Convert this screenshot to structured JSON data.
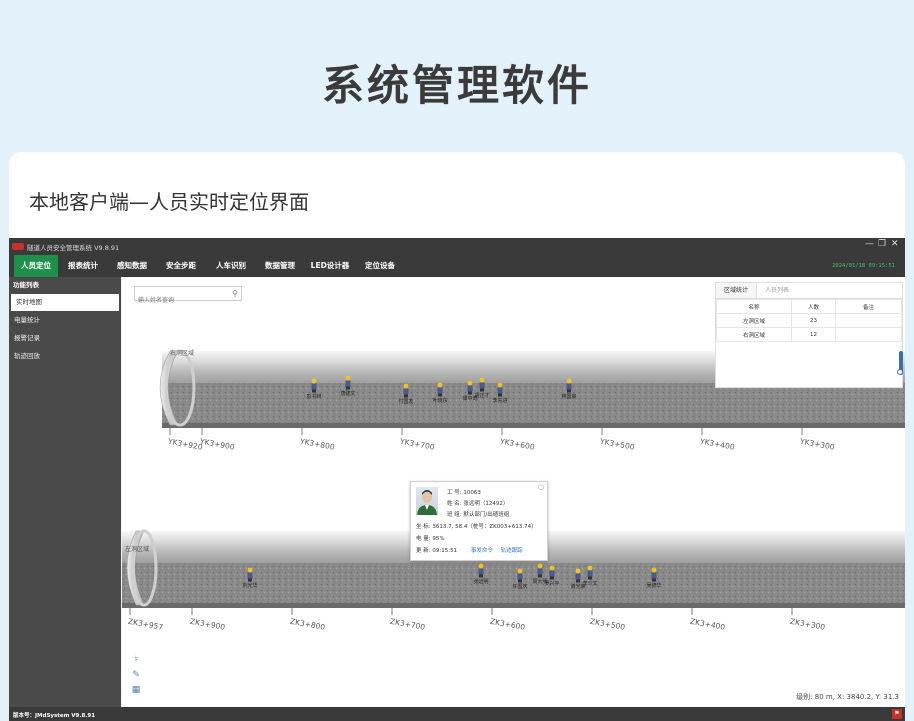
{
  "hero_title": "系统管理软件",
  "caption": "本地客户端—人员实时定位界面",
  "app": {
    "window_title": "隧道人员安全管理系统 V9.8.91",
    "logo_text": "JMD",
    "window_controls": [
      "—",
      "❐",
      "✕"
    ],
    "clock": "2024/01/18 09:15:51",
    "menu": [
      {
        "label": "人员定位",
        "active": true
      },
      {
        "label": "报表统计",
        "active": false
      },
      {
        "label": "感知数据",
        "active": false
      },
      {
        "label": "安全步距",
        "active": false
      },
      {
        "label": "人车识别",
        "active": false
      },
      {
        "label": "数据管理",
        "active": false
      },
      {
        "label": "LED设计器",
        "active": false
      },
      {
        "label": "定位设备",
        "active": false
      }
    ],
    "sidebar": {
      "header": "功能列表",
      "items": [
        {
          "label": "实时地图",
          "active": true
        },
        {
          "label": "电量统计",
          "active": false
        },
        {
          "label": "报警记录",
          "active": false
        },
        {
          "label": "轨迹回放",
          "active": false
        }
      ]
    },
    "search": {
      "placeholder": "输入姓名查询"
    },
    "stats": {
      "tabs": [
        {
          "label": "区域统计",
          "active": true
        },
        {
          "label": "人员列表",
          "active": false
        }
      ],
      "headers": [
        "名称",
        "人数",
        "备注"
      ],
      "rows": [
        [
          "左洞区域",
          "23",
          ""
        ],
        [
          "右洞区域",
          "12",
          ""
        ]
      ]
    },
    "tunnels": {
      "right": {
        "label": "右洞区域",
        "stations": [
          "YK3+920",
          "YK3+900",
          "YK3+800",
          "YK3+700",
          "YK3+600",
          "YK3+500",
          "YK3+400",
          "YK3+300"
        ],
        "workers": [
          "彭书林",
          "唐建文",
          "付国友",
          "叶晓东",
          "谭中奇",
          "胡正才",
          "李先进",
          "蒋国良"
        ]
      },
      "left": {
        "label": "左洞区域",
        "stations": [
          "ZK3+957",
          "ZK3+900",
          "ZK3+800",
          "ZK3+700",
          "ZK3+600",
          "ZK3+500",
          "ZK3+400",
          "ZK3+300"
        ],
        "workers": [
          "刘光华",
          "张远明",
          "许国庆",
          "周大明",
          "罗兴平",
          "谢光荣",
          "李少文",
          "吴德华"
        ]
      }
    },
    "popup": {
      "id_label": "工 号:",
      "id_value": "10063",
      "name_label": "姓 名:",
      "name_value": "张远明（12492）",
      "group_label": "班 组:",
      "group_value": "默认部门/出碴班组",
      "coord_label": "坐 标:",
      "coord_value": "3613.7, 58.4（桩号：ZK003+613.74）",
      "battery_label": "电 量:",
      "battery_value": "95%",
      "update_label": "更 新:",
      "update_value": "09:15:51",
      "link_command": "事发命令",
      "link_track": "轨迹跟踪",
      "close": "○"
    },
    "readout": "级别: 80 m,  X: 3840.2,  Y: 31.3",
    "version": "版本号：JMdSystem V9.8.91"
  }
}
